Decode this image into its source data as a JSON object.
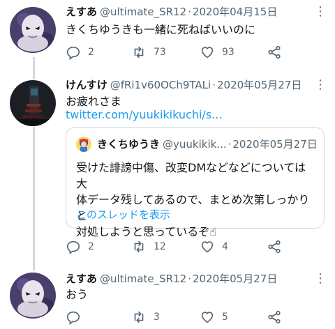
{
  "tweets": [
    {
      "name": "えすあ",
      "handle": "@ultimate_SR12",
      "separator": "·",
      "date": "2020年04月15日",
      "text": "きくちゆうきも一緒に死ねばいいのに",
      "actions": {
        "replies": "2",
        "retweets": "73",
        "likes": "93"
      }
    },
    {
      "name": "けんすけ",
      "handle": "@fRi1v60OCh9TALi",
      "separator": "·",
      "date": "2020年05月27日",
      "text": "お疲れさま",
      "link": "twitter.com/yuukikikuchi/s...",
      "quote": {
        "name": "きくちゆうき",
        "handle": "@yuukikik...",
        "separator": "·",
        "date": "2020年05月27日",
        "line1": "受けた誹謗中傷、改変DMなどなどについては大",
        "line2": "体データ残してあるので、まとめ次第しっかりと",
        "line3": "対処しようと思っているぞ☝",
        "thread_link": "このスレッドを表示"
      },
      "actions": {
        "replies": "2",
        "retweets": "12",
        "likes": "4"
      }
    },
    {
      "name": "えすあ",
      "handle": "@ultimate_SR12",
      "separator": "·",
      "date": "2020年05月27日",
      "text": "おう",
      "actions": {
        "replies": "",
        "retweets": "3",
        "likes": "5"
      }
    }
  ],
  "icons": {
    "more": "more-vertical-icon",
    "reply": "reply-icon",
    "retweet": "retweet-icon",
    "like": "heart-icon",
    "share": "share-icon"
  },
  "more_glyph": "⋮",
  "colors": {
    "link": "#1d9bf0",
    "muted": "#536471",
    "thread_line": "#cfd9de"
  }
}
